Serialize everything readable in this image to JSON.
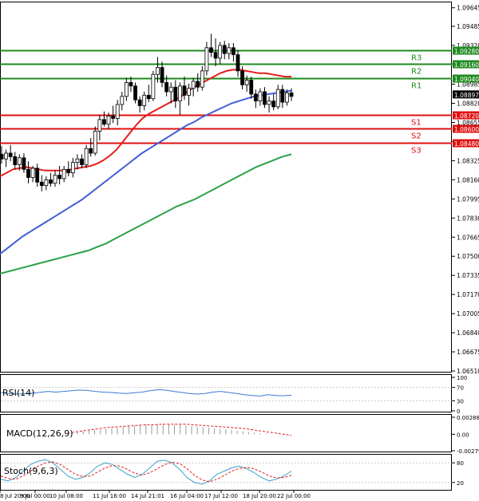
{
  "chart_data": {
    "type": "candlestick",
    "symbol": "EURUSD",
    "main_panel": {
      "ylim": [
        1.0651,
        1.0965
      ],
      "y_ticks": [
        "1.09645",
        "1.09485",
        "1.09320",
        "1.09160",
        "1.08985",
        "1.08820",
        "1.08655",
        "1.08490",
        "1.08325",
        "1.08160",
        "1.07995",
        "1.07830",
        "1.07665",
        "1.07500",
        "1.07335",
        "1.07170",
        "1.07005",
        "1.06840",
        "1.06675",
        "1.06510"
      ],
      "current_price": {
        "value": 1.08897,
        "label": "1.08897"
      },
      "levels": [
        {
          "name": "R3",
          "value": 1.0928,
          "label": "1.09280",
          "color": "#1e8a1e"
        },
        {
          "name": "R2",
          "value": 1.0916,
          "label": "1.09160",
          "color": "#1e8a1e"
        },
        {
          "name": "R1",
          "value": 1.0904,
          "label": "1.09040",
          "color": "#1e8a1e"
        },
        {
          "name": "S1",
          "value": 1.0872,
          "label": "1.08720",
          "color": "#e01010"
        },
        {
          "name": "S2",
          "value": 1.086,
          "label": "1.08600",
          "color": "#e01010"
        },
        {
          "name": "S3",
          "value": 1.0848,
          "label": "1.08480",
          "color": "#e01010"
        }
      ],
      "candles": [
        {
          "o": 1.0838,
          "h": 1.0845,
          "l": 1.083,
          "c": 1.0834
        },
        {
          "o": 1.0834,
          "h": 1.0842,
          "l": 1.0827,
          "c": 1.0839
        },
        {
          "o": 1.0839,
          "h": 1.0846,
          "l": 1.0832,
          "c": 1.0836
        },
        {
          "o": 1.0836,
          "h": 1.084,
          "l": 1.0825,
          "c": 1.0829
        },
        {
          "o": 1.0829,
          "h": 1.0838,
          "l": 1.0824,
          "c": 1.0835
        },
        {
          "o": 1.0835,
          "h": 1.0839,
          "l": 1.0822,
          "c": 1.0825
        },
        {
          "o": 1.0825,
          "h": 1.0832,
          "l": 1.0813,
          "c": 1.0818
        },
        {
          "o": 1.0818,
          "h": 1.0828,
          "l": 1.0814,
          "c": 1.0826
        },
        {
          "o": 1.0826,
          "h": 1.083,
          "l": 1.081,
          "c": 1.0814
        },
        {
          "o": 1.0814,
          "h": 1.082,
          "l": 1.0806,
          "c": 1.0811
        },
        {
          "o": 1.0811,
          "h": 1.0819,
          "l": 1.0807,
          "c": 1.0816
        },
        {
          "o": 1.0816,
          "h": 1.0822,
          "l": 1.081,
          "c": 1.0813
        },
        {
          "o": 1.0813,
          "h": 1.0824,
          "l": 1.081,
          "c": 1.082
        },
        {
          "o": 1.082,
          "h": 1.0828,
          "l": 1.0812,
          "c": 1.0817
        },
        {
          "o": 1.0817,
          "h": 1.0828,
          "l": 1.0814,
          "c": 1.0825
        },
        {
          "o": 1.0825,
          "h": 1.0832,
          "l": 1.0819,
          "c": 1.0822
        },
        {
          "o": 1.0822,
          "h": 1.0835,
          "l": 1.0818,
          "c": 1.0831
        },
        {
          "o": 1.0831,
          "h": 1.0838,
          "l": 1.0825,
          "c": 1.0834
        },
        {
          "o": 1.0834,
          "h": 1.0838,
          "l": 1.0826,
          "c": 1.0829
        },
        {
          "o": 1.0829,
          "h": 1.0846,
          "l": 1.0826,
          "c": 1.0843
        },
        {
          "o": 1.0843,
          "h": 1.0852,
          "l": 1.0836,
          "c": 1.0839
        },
        {
          "o": 1.0839,
          "h": 1.0862,
          "l": 1.0837,
          "c": 1.0858
        },
        {
          "o": 1.0858,
          "h": 1.0872,
          "l": 1.085,
          "c": 1.0868
        },
        {
          "o": 1.0868,
          "h": 1.0875,
          "l": 1.0862,
          "c": 1.0864
        },
        {
          "o": 1.0864,
          "h": 1.0874,
          "l": 1.086,
          "c": 1.0871
        },
        {
          "o": 1.0871,
          "h": 1.088,
          "l": 1.0865,
          "c": 1.0869
        },
        {
          "o": 1.0869,
          "h": 1.0885,
          "l": 1.0863,
          "c": 1.0881
        },
        {
          "o": 1.0881,
          "h": 1.0892,
          "l": 1.0876,
          "c": 1.0888
        },
        {
          "o": 1.0888,
          "h": 1.0904,
          "l": 1.0884,
          "c": 1.09
        },
        {
          "o": 1.09,
          "h": 1.0905,
          "l": 1.0892,
          "c": 1.0897
        },
        {
          "o": 1.0897,
          "h": 1.09,
          "l": 1.0882,
          "c": 1.0885
        },
        {
          "o": 1.0885,
          "h": 1.0888,
          "l": 1.0874,
          "c": 1.088
        },
        {
          "o": 1.088,
          "h": 1.0892,
          "l": 1.0876,
          "c": 1.0889
        },
        {
          "o": 1.0889,
          "h": 1.0898,
          "l": 1.0883,
          "c": 1.0886
        },
        {
          "o": 1.0886,
          "h": 1.091,
          "l": 1.0884,
          "c": 1.0907
        },
        {
          "o": 1.0907,
          "h": 1.0922,
          "l": 1.09,
          "c": 1.0913
        },
        {
          "o": 1.0913,
          "h": 1.0918,
          "l": 1.0896,
          "c": 1.09
        },
        {
          "o": 1.09,
          "h": 1.0906,
          "l": 1.0888,
          "c": 1.0892
        },
        {
          "o": 1.0892,
          "h": 1.09,
          "l": 1.0882,
          "c": 1.0896
        },
        {
          "o": 1.0896,
          "h": 1.0902,
          "l": 1.0878,
          "c": 1.0884
        },
        {
          "o": 1.0884,
          "h": 1.09,
          "l": 1.0872,
          "c": 1.0897
        },
        {
          "o": 1.0897,
          "h": 1.0905,
          "l": 1.0885,
          "c": 1.0889
        },
        {
          "o": 1.0889,
          "h": 1.0899,
          "l": 1.088,
          "c": 1.0895
        },
        {
          "o": 1.0895,
          "h": 1.0904,
          "l": 1.0888,
          "c": 1.0901
        },
        {
          "o": 1.0901,
          "h": 1.0908,
          "l": 1.0892,
          "c": 1.0896
        },
        {
          "o": 1.0896,
          "h": 1.0914,
          "l": 1.0893,
          "c": 1.091
        },
        {
          "o": 1.091,
          "h": 1.0935,
          "l": 1.0906,
          "c": 1.093
        },
        {
          "o": 1.093,
          "h": 1.0942,
          "l": 1.0922,
          "c": 1.0926
        },
        {
          "o": 1.0926,
          "h": 1.0938,
          "l": 1.0914,
          "c": 1.0921
        },
        {
          "o": 1.0921,
          "h": 1.0935,
          "l": 1.0916,
          "c": 1.0932
        },
        {
          "o": 1.0932,
          "h": 1.0936,
          "l": 1.092,
          "c": 1.0925
        },
        {
          "o": 1.0925,
          "h": 1.0934,
          "l": 1.092,
          "c": 1.093
        },
        {
          "o": 1.093,
          "h": 1.0934,
          "l": 1.0918,
          "c": 1.0924
        },
        {
          "o": 1.0924,
          "h": 1.0928,
          "l": 1.0905,
          "c": 1.091
        },
        {
          "o": 1.091,
          "h": 1.0914,
          "l": 1.0894,
          "c": 1.0898
        },
        {
          "o": 1.0898,
          "h": 1.0906,
          "l": 1.0892,
          "c": 1.0902
        },
        {
          "o": 1.0902,
          "h": 1.0905,
          "l": 1.0886,
          "c": 1.089
        },
        {
          "o": 1.089,
          "h": 1.0894,
          "l": 1.0878,
          "c": 1.0884
        },
        {
          "o": 1.0884,
          "h": 1.0895,
          "l": 1.088,
          "c": 1.0892
        },
        {
          "o": 1.0892,
          "h": 1.0896,
          "l": 1.0878,
          "c": 1.0881
        },
        {
          "o": 1.0881,
          "h": 1.0888,
          "l": 1.0874,
          "c": 1.0884
        },
        {
          "o": 1.0884,
          "h": 1.089,
          "l": 1.0876,
          "c": 1.0879
        },
        {
          "o": 1.0879,
          "h": 1.0898,
          "l": 1.0877,
          "c": 1.0894
        },
        {
          "o": 1.0894,
          "h": 1.0898,
          "l": 1.0878,
          "c": 1.0883
        },
        {
          "o": 1.0883,
          "h": 1.0894,
          "l": 1.088,
          "c": 1.0891
        },
        {
          "o": 1.0891,
          "h": 1.0895,
          "l": 1.0884,
          "c": 1.0888
        }
      ],
      "moving_averages": [
        {
          "name": "red",
          "color": "#e41b1b",
          "values": [
            1.0819,
            1.0822,
            1.0825,
            1.0826,
            1.0827,
            1.0826,
            1.0825,
            1.0824,
            1.0824,
            1.0824,
            1.0824,
            1.0825,
            1.0826,
            1.0827,
            1.0828,
            1.083,
            1.0833,
            1.0837,
            1.0842,
            1.0849,
            1.0856,
            1.0863,
            1.0869,
            1.0873,
            1.0876,
            1.0879,
            1.0882,
            1.0885,
            1.0888,
            1.0892,
            1.0896,
            1.0899,
            1.0902,
            1.0905,
            1.0908,
            1.091,
            1.0911,
            1.0911,
            1.091,
            1.0909,
            1.0908,
            1.0908,
            1.0907,
            1.0906,
            1.0905,
            1.0905
          ]
        },
        {
          "name": "blue",
          "color": "#3f5fd6",
          "values": [
            1.0752,
            1.0757,
            1.0762,
            1.0767,
            1.0771,
            1.0775,
            1.0779,
            1.0783,
            1.0787,
            1.0791,
            1.0795,
            1.0799,
            1.0804,
            1.0809,
            1.0814,
            1.0819,
            1.0824,
            1.0829,
            1.0834,
            1.0839,
            1.0843,
            1.0847,
            1.0851,
            1.0855,
            1.0859,
            1.0863,
            1.0866,
            1.087,
            1.0873,
            1.0876,
            1.0879,
            1.0882,
            1.0884,
            1.0886,
            1.0888,
            1.0889,
            1.089,
            1.0891,
            1.0892,
            1.0893
          ]
        },
        {
          "name": "green",
          "color": "#2aa24a",
          "values": [
            1.0735,
            1.0737,
            1.0739,
            1.0741,
            1.0743,
            1.0745,
            1.0747,
            1.0749,
            1.0751,
            1.0753,
            1.0755,
            1.0758,
            1.0761,
            1.0765,
            1.0769,
            1.0773,
            1.0777,
            1.0781,
            1.0785,
            1.0789,
            1.0793,
            1.0796,
            1.0799,
            1.0803,
            1.0807,
            1.0811,
            1.0815,
            1.0819,
            1.0823,
            1.0827,
            1.083,
            1.0833,
            1.0836,
            1.0838
          ]
        }
      ]
    },
    "indicators": [
      {
        "name": "RSI(14)",
        "y_ticks": [
          "100",
          "70",
          "30",
          "0"
        ],
        "ylim": [
          0,
          100
        ],
        "values": [
          55,
          52,
          50,
          51,
          53,
          55,
          58,
          56,
          58,
          60,
          62,
          61,
          58,
          56,
          55,
          53,
          52,
          54,
          56,
          60,
          63,
          62,
          58,
          55,
          52,
          50,
          52,
          56,
          58,
          55,
          52,
          48,
          46,
          44,
          48,
          46,
          45,
          47
        ]
      },
      {
        "name": "MACD(12,26,9)",
        "y_ticks": [
          "0.002883",
          "0.00",
          "-0.002795"
        ],
        "ylim": [
          -0.002795,
          0.002883
        ],
        "histogram": [
          0.0002,
          0.0004,
          0.0005,
          0.0006,
          0.0007,
          0.0008,
          0.0009,
          0.001,
          0.0011,
          0.0012,
          0.0013,
          0.0014,
          0.0015,
          0.0016,
          0.0016,
          0.0017,
          0.0017,
          0.0017,
          0.0016,
          0.0016,
          0.0015,
          0.0014,
          0.0013,
          0.0012,
          0.0011,
          0.001,
          0.0009,
          0.0008,
          0.0007,
          0.0006,
          0.0005,
          0.0004,
          0.0003,
          0.0002,
          0.0001,
          0.0
        ],
        "signal": [
          0.0003,
          0.0005,
          0.0007,
          0.0009,
          0.0011,
          0.0012,
          0.0013,
          0.0014,
          0.0015,
          0.0016,
          0.0016,
          0.0017,
          0.0017,
          0.0017,
          0.0017,
          0.0016,
          0.0015,
          0.0014,
          0.0013,
          0.0012,
          0.0011,
          0.001,
          0.0008,
          0.0006,
          0.0004,
          0.0002,
          0.0,
          -0.0002
        ]
      },
      {
        "name": "Stoch(9,6,3)",
        "y_ticks": [
          "80",
          "20"
        ],
        "ylim": [
          0,
          100
        ],
        "main": [
          30,
          25,
          35,
          55,
          75,
          85,
          90,
          80,
          60,
          40,
          30,
          35,
          50,
          70,
          80,
          75,
          60,
          45,
          35,
          45,
          65,
          85,
          88,
          80,
          60,
          35,
          20,
          15,
          25,
          45,
          55,
          65,
          70,
          62,
          50,
          35,
          25,
          30,
          40,
          55
        ],
        "signal": [
          40,
          32,
          30,
          40,
          55,
          70,
          80,
          83,
          75,
          60,
          45,
          38,
          40,
          52,
          65,
          72,
          70,
          60,
          48,
          42,
          50,
          62,
          75,
          82,
          78,
          62,
          42,
          28,
          22,
          30,
          42,
          55,
          63,
          66,
          62,
          52,
          40,
          34,
          35,
          42
        ]
      }
    ],
    "x_tick_labels": [
      "8 Jul 20:00",
      "9 Jul 00:00",
      "10 Jul 08:00",
      "11 Jul 16:00",
      "14 Jul 21:01",
      "16 Jul 04:00",
      "17 Jul 12:00",
      "18 Jul 20:00",
      "22 Jul 00:00"
    ]
  }
}
